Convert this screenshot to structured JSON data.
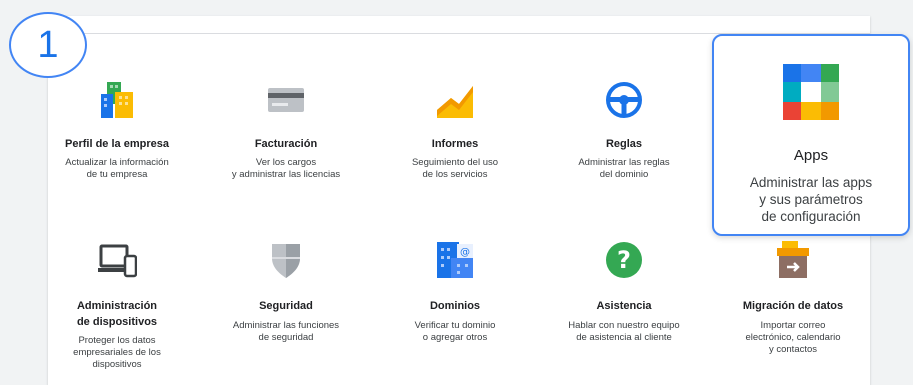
{
  "step_badge": "1",
  "row1": [
    {
      "title": "Perfil de la empresa",
      "desc": "Actualizar la información\nde tu empresa",
      "icon": "company-profile-icon"
    },
    {
      "title": "Facturación",
      "desc": "Ver los cargos\ny administrar las licencias",
      "icon": "billing-card-icon"
    },
    {
      "title": "Informes",
      "desc": "Seguimiento del uso\nde los servicios",
      "icon": "reports-chart-icon"
    },
    {
      "title": "Reglas",
      "desc": "Administrar las reglas\ndel dominio",
      "icon": "steering-wheel-icon"
    }
  ],
  "apps": {
    "title": "Apps",
    "desc": "Administrar las apps\ny sus parámetros\nde configuración",
    "icon": "apps-grid-icon"
  },
  "row2": [
    {
      "title": "Administración\nde dispositivos",
      "desc": "Proteger los datos\nempresariales de los\ndispositivos",
      "icon": "devices-icon"
    },
    {
      "title": "Seguridad",
      "desc": "Administrar las funciones\nde seguridad",
      "icon": "shield-icon"
    },
    {
      "title": "Dominios",
      "desc": "Verificar tu dominio\no agregar otros",
      "icon": "domains-building-icon"
    },
    {
      "title": "Asistencia",
      "desc": "Hablar con nuestro equipo\nde asistencia al cliente",
      "icon": "help-question-icon"
    },
    {
      "title": "Migración de datos",
      "desc": "Importar correo\nelectrónico, calendario\ny contactos",
      "icon": "data-migration-box-icon"
    }
  ]
}
